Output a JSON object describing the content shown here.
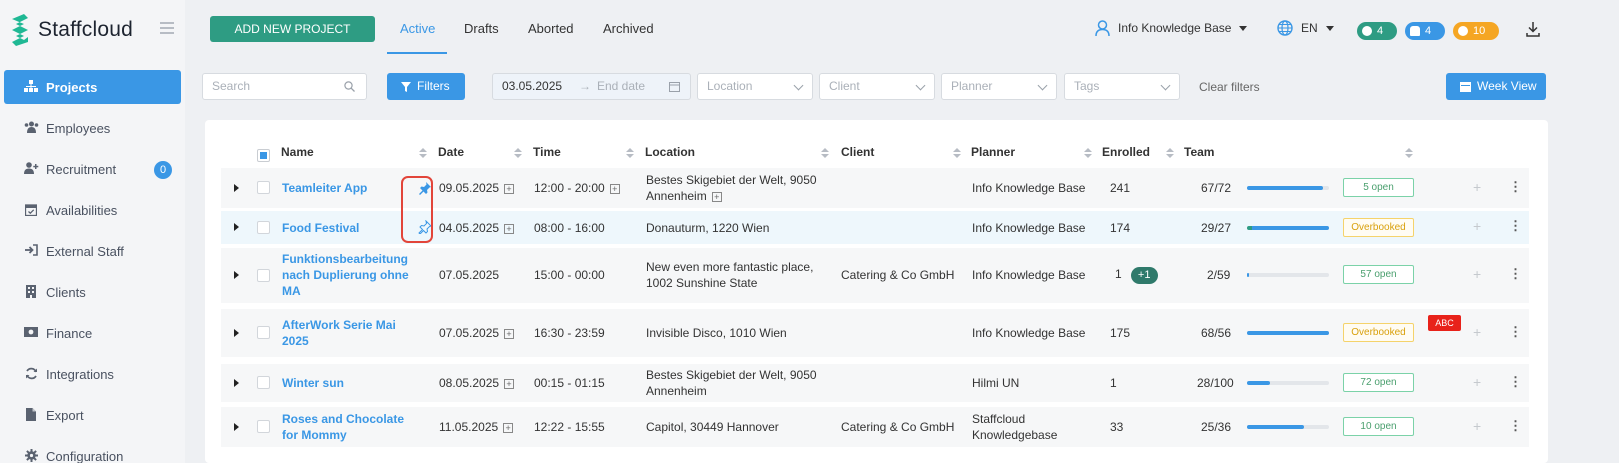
{
  "app": {
    "name": "Staffcloud"
  },
  "sidebar": {
    "items": [
      {
        "label": "Projects",
        "icon": "sitemap-icon",
        "active": true
      },
      {
        "label": "Employees",
        "icon": "users-icon"
      },
      {
        "label": "Recruitment",
        "icon": "user-plus-icon",
        "badge": "0"
      },
      {
        "label": "Availabilities",
        "icon": "calendar-check-icon"
      },
      {
        "label": "External Staff",
        "icon": "sign-in-icon"
      },
      {
        "label": "Clients",
        "icon": "building-icon"
      },
      {
        "label": "Finance",
        "icon": "money-icon"
      },
      {
        "label": "Integrations",
        "icon": "sync-icon"
      },
      {
        "label": "Export",
        "icon": "file-icon"
      },
      {
        "label": "Configuration",
        "icon": "cog-icon"
      }
    ]
  },
  "topbar": {
    "add_button": "ADD NEW PROJECT",
    "tabs": [
      "Active",
      "Drafts",
      "Aborted",
      "Archived"
    ],
    "user": "Info Knowledge Base",
    "language": "EN",
    "chat_count": "4",
    "bell_count": "4",
    "timer_count": "10",
    "colors": {
      "chat": "#2e9c83",
      "bell": "#3a97e5",
      "timer": "#f5a623"
    }
  },
  "filters": {
    "search_placeholder": "Search",
    "filters_button": "Filters",
    "start_date": "03.05.2025",
    "end_date_placeholder": "End date",
    "location_placeholder": "Location",
    "client_placeholder": "Client",
    "planner_placeholder": "Planner",
    "tags_placeholder": "Tags",
    "clear": "Clear filters",
    "week_view": "Week View"
  },
  "table": {
    "headers": {
      "name": "Name",
      "date": "Date",
      "time": "Time",
      "location": "Location",
      "client": "Client",
      "planner": "Planner",
      "enrolled": "Enrolled",
      "team": "Team"
    },
    "rows": [
      {
        "name1": "Teamleiter App",
        "name2": "",
        "name3": "",
        "date": "09.05.2025",
        "time": "12:00 - 20:00",
        "loc1": "Bestes Skigebiet der Welt, 9050",
        "loc2": "Annenheim",
        "client": "",
        "planner1": "Info Knowledge Base",
        "planner2": "",
        "enrolled": "241",
        "team": "67/72",
        "fill": 0.93,
        "status": "5 open",
        "pinned": true
      },
      {
        "name1": "Food Festival",
        "name2": "",
        "name3": "",
        "date": "04.05.2025",
        "time": "08:00 - 16:00",
        "loc1": "Donauturm, 1220 Wien",
        "loc2": "",
        "client": "",
        "planner1": "Info Knowledge Base",
        "planner2": "",
        "enrolled": "174",
        "team": "29/27",
        "fill": 1.0,
        "status": "Overbooked",
        "pinned": false
      },
      {
        "name1": "Funktionsbearbeitung",
        "name2": "nach Duplierung ohne",
        "name3": "MA",
        "date": "07.05.2025",
        "time": "15:00 - 00:00",
        "loc1": "New even more fantastic place,",
        "loc2": "1002 Sunshine State",
        "client": "Catering & Co GmbH",
        "planner1": "Info Knowledge Base",
        "planner2": "",
        "enrolled": "1",
        "enrolled_extra": "+1",
        "team": "2/59",
        "fill": 0.03,
        "status": "57 open"
      },
      {
        "name1": "AfterWork Serie Mai",
        "name2": "2025",
        "name3": "",
        "date": "07.05.2025",
        "time": "16:30 - 23:59",
        "loc1": "Invisible Disco, 1010 Wien",
        "loc2": "",
        "client": "",
        "planner1": "Info Knowledge Base",
        "planner2": "",
        "enrolled": "175",
        "team": "68/56",
        "fill": 1.0,
        "status": "Overbooked",
        "tag": "ABC"
      },
      {
        "name1": "Winter sun",
        "name2": "",
        "name3": "",
        "date": "08.05.2025",
        "time": "00:15 - 01:15",
        "loc1": "Bestes Skigebiet der Welt, 9050",
        "loc2": "Annenheim",
        "client": "",
        "planner1": "Hilmi UN",
        "planner2": "",
        "enrolled": "1",
        "team": "28/100",
        "fill": 0.28,
        "status": "72 open"
      },
      {
        "name1": "Roses and Chocolate",
        "name2": "for Mommy",
        "name3": "",
        "date": "11.05.2025",
        "time": "12:22 - 15:55",
        "loc1": "Capitol, 30449 Hannover",
        "loc2": "",
        "client": "Catering & Co GmbH",
        "planner1": "Staffcloud",
        "planner2": "Knowledgebase",
        "enrolled": "33",
        "team": "25/36",
        "fill": 0.69,
        "status": "10 open"
      }
    ]
  }
}
